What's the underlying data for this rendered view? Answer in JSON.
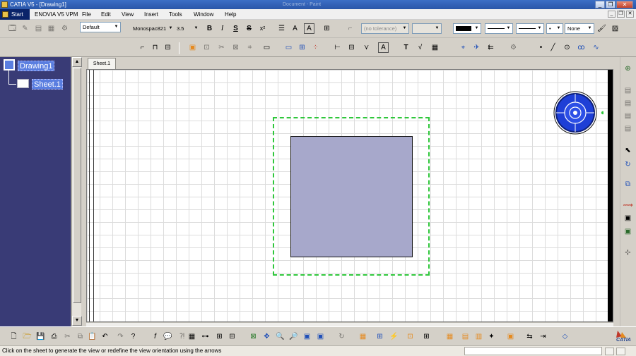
{
  "window": {
    "title": "CATIA V5 - [Drawing1]",
    "faded_title": "Document - Paint",
    "minimize": "_",
    "restore": "❐",
    "close": "✕"
  },
  "menu": {
    "start": "Start",
    "items": [
      "ENOVIA V5 VPM",
      "File",
      "Edit",
      "View",
      "Insert",
      "Tools",
      "Window",
      "Help"
    ]
  },
  "text_toolbar": {
    "style": "Default",
    "font": "Monospac821",
    "size": "3.5",
    "bold": "B",
    "italic": "I",
    "underline": "S",
    "strike": "S",
    "superscript": "x²",
    "tolerance": "(no tolerance)",
    "line_weight_label": "None"
  },
  "tree": {
    "root": "Drawing1",
    "child": "Sheet.1"
  },
  "sheet_tab": "Sheet.1",
  "status_text": "Click on the sheet to generate the view or redefine the view orientation using the arrows",
  "branding": {
    "logo_text": "CATIA",
    "accent": "#2fc73b",
    "view_fill": "#a7a8cb",
    "tree_bg": "#393b76"
  }
}
